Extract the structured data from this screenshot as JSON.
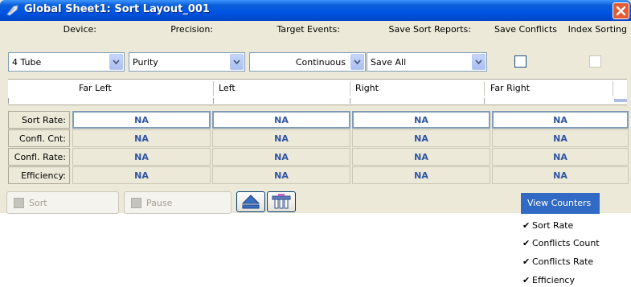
{
  "window": {
    "title": "Global Sheet1: Sort Layout_001"
  },
  "settings": {
    "device": {
      "label": "Device:",
      "value": "4 Tube"
    },
    "precision": {
      "label": "Precision:",
      "value": "Purity"
    },
    "target_events": {
      "label": "Target Events:",
      "value": "Continuous"
    },
    "save_sort_reports": {
      "label": "Save Sort Reports:",
      "value": "Save All"
    },
    "save_conflicts": {
      "label": "Save Conflicts"
    },
    "index_sorting": {
      "label": "Index Sorting"
    }
  },
  "columns": [
    "Far Left",
    "Left",
    "Right",
    "Far Right"
  ],
  "rows": [
    {
      "label": "Sort Rate:",
      "values": [
        "NA",
        "NA",
        "NA",
        "NA"
      ]
    },
    {
      "label": "Confl. Cnt:",
      "values": [
        "NA",
        "NA",
        "NA",
        "NA"
      ]
    },
    {
      "label": "Confl. Rate:",
      "values": [
        "NA",
        "NA",
        "NA",
        "NA"
      ]
    },
    {
      "label": "Efficiency:",
      "values": [
        "NA",
        "NA",
        "NA",
        "NA"
      ]
    }
  ],
  "buttons": {
    "sort": "Sort",
    "pause": "Pause",
    "view_counters": "View Counters"
  },
  "menu": {
    "items": [
      {
        "label": "Sort Rate",
        "checked": "✔"
      },
      {
        "label": "Conflicts Count",
        "checked": "✔"
      },
      {
        "label": "Conflicts Rate",
        "checked": "✔"
      },
      {
        "label": "Efficiency",
        "checked": "✔"
      }
    ]
  },
  "icons": [
    "window-icon",
    "close-icon",
    "dropdown-arrow-icon",
    "eject-icon",
    "tubes-icon",
    "checkmark-icon"
  ],
  "colors": {
    "title_bar": "#0054e3",
    "close": "#e35a33",
    "value_text": "#3155a6",
    "menu_highlight": "#316ac5",
    "window_bg": "#ece9d8"
  }
}
